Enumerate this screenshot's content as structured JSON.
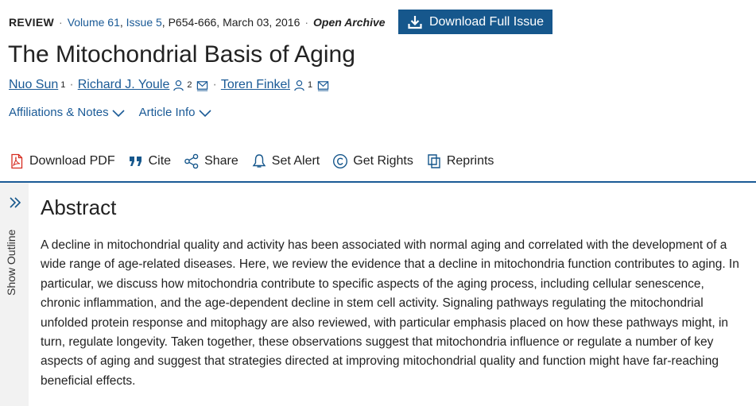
{
  "meta": {
    "type_label": "REVIEW",
    "volume": "Volume 61",
    "issue": "Issue 5",
    "pages": "P654-666",
    "date": "March 03, 2016",
    "access": "Open Archive"
  },
  "download_issue_label": "Download Full Issue",
  "title": "The Mitochondrial Basis of Aging",
  "authors": [
    {
      "name": "Nuo Sun",
      "sup": "1"
    },
    {
      "name": "Richard J. Youle",
      "sup": "2"
    },
    {
      "name": "Toren Finkel",
      "sup": "1"
    }
  ],
  "info_links": {
    "affiliations": "Affiliations & Notes",
    "article_info": "Article Info"
  },
  "toolbar": {
    "download_pdf": "Download PDF",
    "cite": "Cite",
    "share": "Share",
    "set_alert": "Set Alert",
    "get_rights": "Get Rights",
    "reprints": "Reprints"
  },
  "outline_label": "Show Outline",
  "abstract": {
    "heading": "Abstract",
    "text": "A decline in mitochondrial quality and activity has been associated with normal aging and correlated with the development of a wide range of age-related diseases. Here, we review the evidence that a decline in mitochondria function contributes to aging. In particular, we discuss how mitochondria contribute to specific aspects of the aging process, including cellular senescence, chronic inflammation, and the age-dependent decline in stem cell activity. Signaling pathways regulating the mitochondrial unfolded protein response and mitophagy are also reviewed, with particular emphasis placed on how these pathways might, in turn, regulate longevity. Taken together, these observations suggest that mitochondria influence or regulate a number of key aspects of aging and suggest that strategies directed at improving mitochondrial quality and function might have far-reaching beneficial effects."
  },
  "colors": {
    "accent": "#16578c",
    "link": "#1a5a96",
    "pdf_red": "#d62b1f"
  }
}
